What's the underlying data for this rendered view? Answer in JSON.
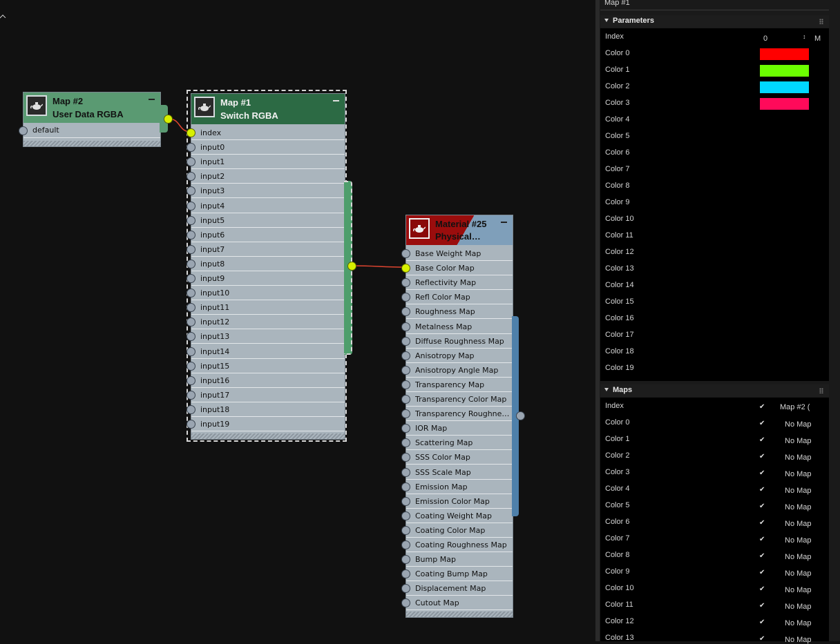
{
  "nodes": {
    "map2": {
      "title": "Map #2",
      "subtitle": "User Data RGBA",
      "ports": [
        "default"
      ]
    },
    "map1": {
      "title": "Map #1",
      "subtitle": "Switch RGBA",
      "ports": [
        "index",
        "input0",
        "input1",
        "input2",
        "input3",
        "input4",
        "input5",
        "input6",
        "input7",
        "input8",
        "input9",
        "input10",
        "input11",
        "input12",
        "input13",
        "input14",
        "input15",
        "input16",
        "input17",
        "input18",
        "input19"
      ]
    },
    "mat25": {
      "title": "Material #25",
      "subtitle": "Physical…",
      "ports": [
        "Base Weight Map",
        "Base Color Map",
        "Reflectivity Map",
        "Refl Color Map",
        "Roughness Map",
        "Metalness Map",
        "Diffuse Roughness Map",
        "Anisotropy Map",
        "Anisotropy Angle Map",
        "Transparency Map",
        "Transparency Color Map",
        "Transparency Roughnes…",
        "IOR Map",
        "Scattering Map",
        "SSS Color Map",
        "SSS Scale Map",
        "Emission Map",
        "Emission Color Map",
        "Coating Weight Map",
        "Coating Color Map",
        "Coating Roughness Map",
        "Bump Map",
        "Coating Bump Map",
        "Displacement Map",
        "Cutout Map"
      ]
    }
  },
  "panel": {
    "top_title": "Map #1",
    "parameters": {
      "header": "Parameters",
      "index_label": "Index",
      "index_value": "0",
      "index_m": "M",
      "colors": [
        "Color 0",
        "Color 1",
        "Color 2",
        "Color 3",
        "Color 4",
        "Color 5",
        "Color 6",
        "Color 7",
        "Color 8",
        "Color 9",
        "Color 10",
        "Color 11",
        "Color 12",
        "Color 13",
        "Color 14",
        "Color 15",
        "Color 16",
        "Color 17",
        "Color 18",
        "Color 19"
      ],
      "swatches": [
        "#ff0000",
        "#6cff00",
        "#00d8ff",
        "#ff0a5a"
      ]
    },
    "maps": {
      "header": "Maps",
      "index_label": "Index",
      "index_map": "Map #2 (",
      "rows": [
        "Color 0",
        "Color 1",
        "Color 2",
        "Color 3",
        "Color 4",
        "Color 5",
        "Color 6",
        "Color 7",
        "Color 8",
        "Color 9",
        "Color 10",
        "Color 11",
        "Color 12",
        "Color 13"
      ],
      "no_map": "No Map",
      "check": "✔"
    }
  },
  "colors": {
    "map2_header": "#5a9a72",
    "map1_header": "#2c6a44",
    "mat_header_blue": "#7f9fba",
    "mat_header_red": "#9a0d0d",
    "wire": "#e04530",
    "socket_active": "#d7f000"
  }
}
